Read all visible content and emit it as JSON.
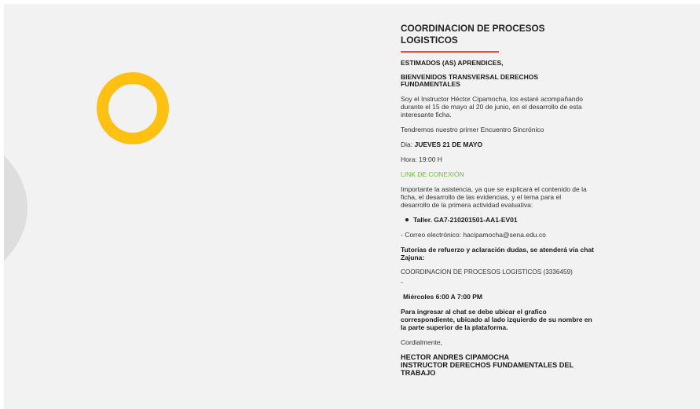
{
  "course": {
    "title_line1": "COORDINACION DE PROCESOS",
    "title_line2": "LOGISTICOS"
  },
  "message": {
    "greeting": "ESTIMADOS (AS) APRENDICES,",
    "welcome_line1": "BIENVENIDOS TRANSVERSAL DERECHOS",
    "welcome_line2": "FUNDAMENTALES",
    "intro_line1": "Soy el Instructor Héctor Cipamocha, los estaré acompañando",
    "intro_line2": "durante el 15 de mayo al 20 de junio, en el desarrollo de esta",
    "intro_line3": "interesante ficha.",
    "meeting_intro": "Tendremos nuestro primer Encuentro Sincrónico",
    "day_label": "Dia: ",
    "day_value": "JUEVES 21 DE MAYO",
    "time": "Hora: 19:00 H",
    "link_label": "LINK DE CONEXIÓN",
    "importance_line1": "Importante la asistencia, ya que se explicará el contenido de la",
    "importance_line2": "ficha, el desarrollo de las evidencias, y el tema para el",
    "importance_line3": "desarrollo de la primera actividad evaluativa:",
    "activity": "Taller. GA7-210201501-AA1-EV01",
    "email": "- Correo electrónico: hacipamocha@sena.edu.co",
    "tutoring_line1": "Tutorías de refuerzo y aclaración dudas, se atenderá vía chat",
    "tutoring_line2": "Zajuna:",
    "course_code": "COORDINACION DE PROCESOS LOGISTICOS (3336459)",
    "dash": "-",
    "schedule": "Miércoles 6:00 A 7:00 PM",
    "chat_line1": "Para ingresar al chat se debe ubicar el grafico",
    "chat_line2": "correspondiente, ubicado al lado izquierdo de su nombre en",
    "chat_line3": "la parte superior de la plataforma.",
    "closing": "Cordialmente,",
    "signature_line1": "HECTOR ANDRES CIPAMOCHA",
    "signature_line2": "INSTRUCTOR DERECHOS FUNDAMENTALES DEL",
    "signature_line3": "TRABAJO"
  },
  "colors": {
    "accent_underline": "#e2522f",
    "ring": "#fec111",
    "link": "#6bbf3a",
    "background": "#f2f2f2"
  }
}
